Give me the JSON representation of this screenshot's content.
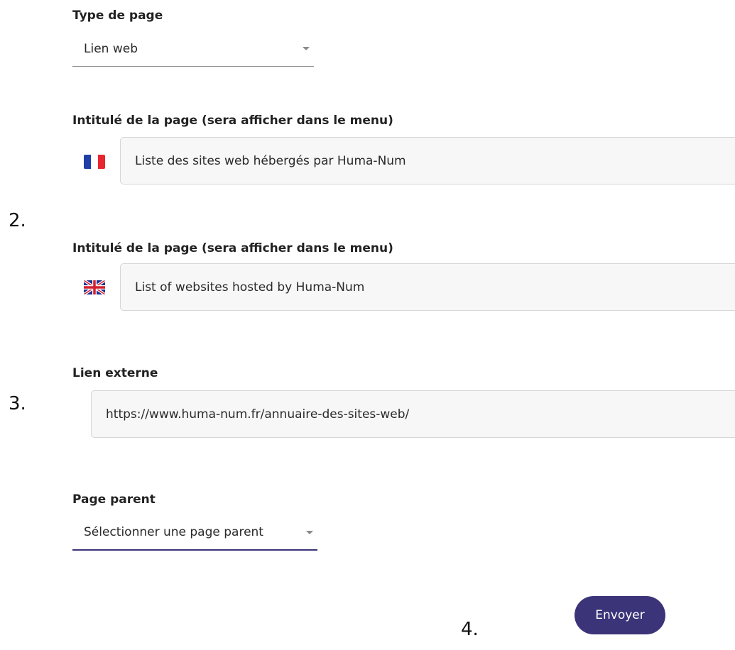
{
  "page_type": {
    "label": "Type de page",
    "value": "Lien web"
  },
  "title_fr": {
    "label": "Intitulé de la page (sera afficher dans le menu)",
    "value": "Liste des sites web hébergés par Huma-Num"
  },
  "title_en": {
    "label": "Intitulé de la page (sera afficher dans le menu)",
    "value": "List of websites hosted by Huma-Num"
  },
  "external_link": {
    "label": "Lien externe",
    "value": "https://www.huma-num.fr/annuaire-des-sites-web/"
  },
  "parent_page": {
    "label": "Page parent",
    "value": "Sélectionner une page parent"
  },
  "submit": {
    "label": "Envoyer"
  },
  "steps": [
    "2.",
    "3.",
    "4."
  ],
  "colors": {
    "accent": "#3b3479",
    "input_bg": "#f7f7f7",
    "flag_fr": [
      "#1f3fa6",
      "#ffffff",
      "#e8262f"
    ],
    "flag_uk": [
      "#1f2f8c",
      "#ffffff",
      "#d41f2f"
    ]
  },
  "icons": {
    "fr_flag": "france-flag-icon",
    "uk_flag": "uk-flag-icon",
    "dropdown": "chevron-down-icon"
  }
}
